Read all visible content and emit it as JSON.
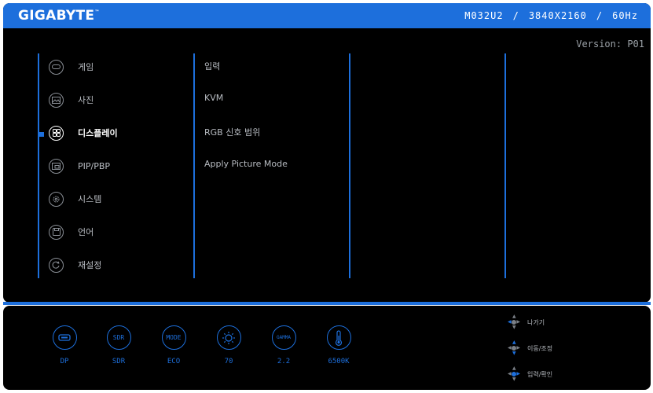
{
  "header": {
    "brand": "GIGABYTE",
    "trademark": "™",
    "model": "M032U2",
    "resolution": "3840X2160",
    "refresh_rate": "60Hz",
    "separator": "/"
  },
  "version": "Version: P01",
  "menu": {
    "active_index": 2,
    "items": [
      {
        "label": "게임",
        "icon": "gamepad-icon"
      },
      {
        "label": "사진",
        "icon": "picture-icon"
      },
      {
        "label": "디스플레이",
        "icon": "display-grid-icon"
      },
      {
        "label": "PIP/PBP",
        "icon": "pip-icon"
      },
      {
        "label": "시스템",
        "icon": "gear-icon"
      },
      {
        "label": "언어",
        "icon": "save-icon"
      },
      {
        "label": "재설정",
        "icon": "reset-icon"
      }
    ]
  },
  "submenu": {
    "items": [
      {
        "label": "입력"
      },
      {
        "label": "KVM"
      },
      {
        "label": "RGB 신호 범위"
      },
      {
        "label": "Apply Picture Mode"
      }
    ]
  },
  "status_bar": {
    "items": [
      {
        "icon": "hdmi-port-icon",
        "icon_text": "",
        "label": "DP"
      },
      {
        "icon": "sdr-icon",
        "icon_text": "SDR",
        "label": "SDR"
      },
      {
        "icon": "mode-icon",
        "icon_text": "MODE",
        "label": "ECO"
      },
      {
        "icon": "brightness-icon",
        "icon_text": "",
        "label": "70"
      },
      {
        "icon": "gamma-icon",
        "icon_text": "GAMMA",
        "label": "2.2"
      },
      {
        "icon": "thermometer-icon",
        "icon_text": "",
        "label": "6500K"
      }
    ]
  },
  "nav_hints": [
    {
      "label": "나가기",
      "icon": "joystick-left-icon"
    },
    {
      "label": "이동/조정",
      "icon": "joystick-updown-icon"
    },
    {
      "label": "입력/확인",
      "icon": "joystick-press-icon"
    }
  ],
  "colors": {
    "accent": "#1d6fdc",
    "background": "#000000",
    "text": "#b8bcc2",
    "active_text": "#ffffff"
  }
}
